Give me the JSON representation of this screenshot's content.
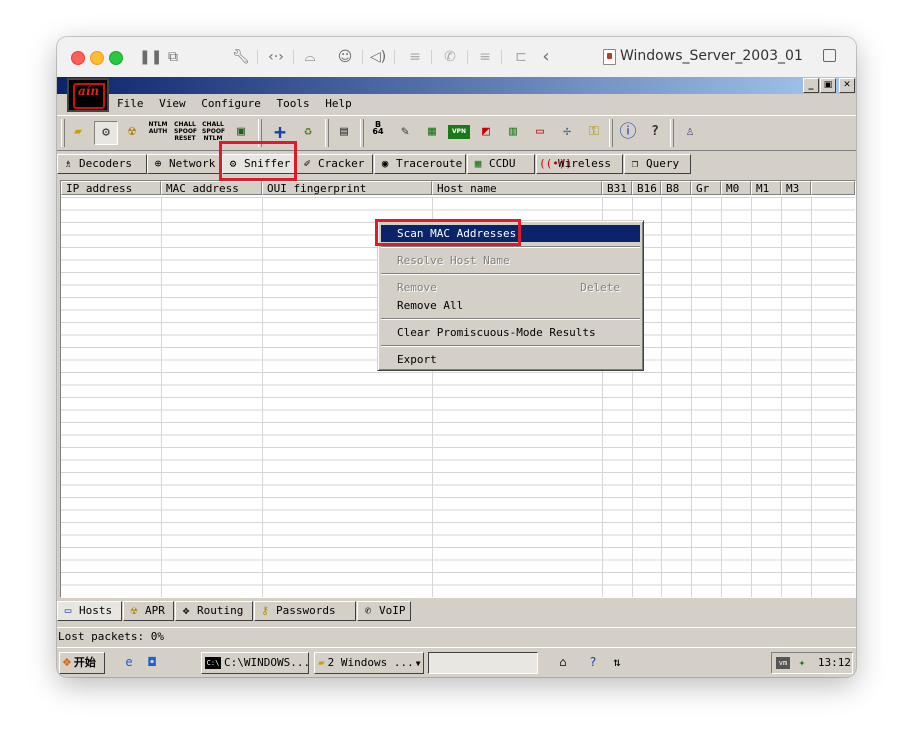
{
  "vm": {
    "title": "Windows_Server_2003_01",
    "toolbar_icons": [
      "pause-icon",
      "snapshot-icon",
      "wrench-icon",
      "arrows-icon",
      "drive-icon",
      "user-icon",
      "speaker-icon",
      "disk-icon",
      "phone-icon",
      "storage-icon",
      "folder-share-icon",
      "back-chevron-icon"
    ]
  },
  "app": {
    "logo_text": "aín",
    "window_controls": {
      "minimize": "_",
      "restore": "▣",
      "close": "✕"
    },
    "menu": [
      "File",
      "View",
      "Configure",
      "Tools",
      "Help"
    ],
    "toolbar": [
      {
        "icon": "folder-open-icon"
      },
      {
        "icon": "sniffer-icon",
        "pressed": true
      },
      {
        "icon": "radiation-icon"
      },
      {
        "icon": "ntlm-auth-icon",
        "l1": "NTLM",
        "l2": "AUTH"
      },
      {
        "icon": "chall-spoof-reset-icon",
        "l1": "CHALL",
        "l2": "SPOOF",
        "l3": "RESET"
      },
      {
        "icon": "chall-spoof-ntlm-icon",
        "l1": "CHALL",
        "l2": "SPOOF",
        "l3": "NTLM"
      },
      {
        "icon": "monitor-icon"
      },
      {
        "icon": "plus-icon"
      },
      {
        "icon": "recycle-icon"
      },
      {
        "icon": "certificate-icon"
      },
      {
        "icon": "base64-icon",
        "l1": "B",
        "l2": "64"
      },
      {
        "icon": "decoder-icon"
      },
      {
        "icon": "ccdu-icon"
      },
      {
        "icon": "vpn-icon",
        "l1": "VPN"
      },
      {
        "icon": "rc-icon"
      },
      {
        "icon": "hash-icon"
      },
      {
        "icon": "tv-icon"
      },
      {
        "icon": "network-icon"
      },
      {
        "icon": "key-icon"
      },
      {
        "icon": "info-icon"
      },
      {
        "icon": "help-icon"
      },
      {
        "icon": "cain-figure-icon"
      }
    ],
    "tabs": [
      {
        "label": "Decoders",
        "icon": "decoders-icon"
      },
      {
        "label": "Network",
        "icon": "network-globe-icon"
      },
      {
        "label": "Sniffer",
        "icon": "sniffer-tab-icon",
        "active": true
      },
      {
        "label": "Cracker",
        "icon": "cracker-icon"
      },
      {
        "label": "Traceroute",
        "icon": "traceroute-icon"
      },
      {
        "label": "CCDU",
        "icon": "ccdu-tab-icon"
      },
      {
        "label": "Wireless",
        "icon": "wireless-icon"
      },
      {
        "label": "Query",
        "icon": "query-icon"
      }
    ],
    "columns": [
      "IP address",
      "MAC address",
      "OUI fingerprint",
      "Host name",
      "B31",
      "B16",
      "B8",
      "Gr",
      "M0",
      "M1",
      "M3"
    ],
    "context_menu": {
      "items": [
        {
          "label": "Scan MAC Addresses",
          "state": "highlighted"
        },
        {
          "label": "Resolve Host Name",
          "state": "disabled"
        },
        {
          "label": "Remove",
          "state": "disabled",
          "shortcut": "Delete"
        },
        {
          "label": "Remove All",
          "state": "enabled"
        },
        {
          "label": "Clear Promiscuous-Mode Results",
          "state": "enabled"
        },
        {
          "label": "Export",
          "state": "enabled"
        }
      ]
    },
    "bottom_tabs": [
      {
        "label": "Hosts",
        "icon": "hosts-icon",
        "active": true
      },
      {
        "label": "APR",
        "icon": "apr-icon"
      },
      {
        "label": "Routing",
        "icon": "routing-icon"
      },
      {
        "label": "Passwords",
        "icon": "passwords-icon"
      },
      {
        "label": "VoIP",
        "icon": "voip-icon"
      }
    ],
    "status": "Lost packets:  0%"
  },
  "taskbar": {
    "start_label": "开始",
    "tasks": [
      {
        "label": "C:\\WINDOWS...",
        "icon": "cmd-icon"
      },
      {
        "label": "2 Windows ...",
        "icon": "folder-icon",
        "has_dropdown": true
      }
    ],
    "time": "13:12"
  },
  "highlight_color": "#e01a2a",
  "menu_selection_color": "#0a246a"
}
